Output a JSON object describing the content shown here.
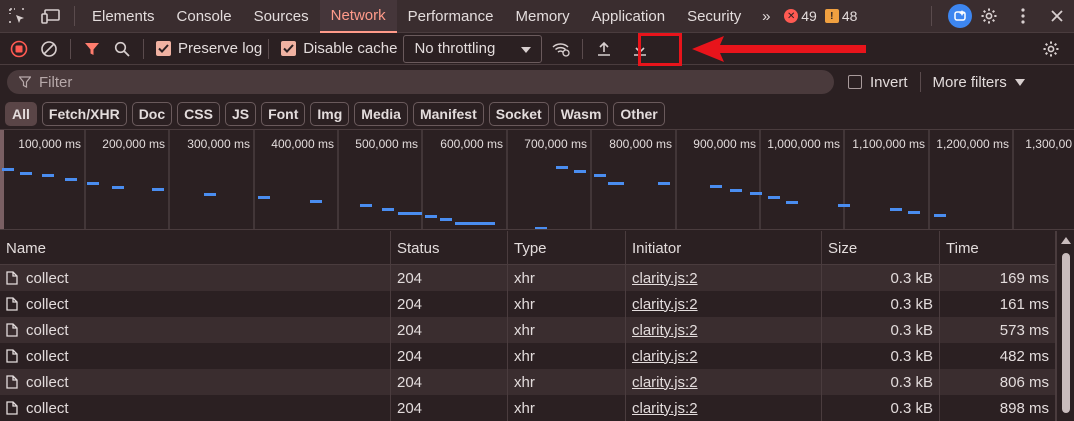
{
  "tabs": [
    {
      "label": "Elements"
    },
    {
      "label": "Console"
    },
    {
      "label": "Sources"
    },
    {
      "label": "Network"
    },
    {
      "label": "Performance"
    },
    {
      "label": "Memory"
    },
    {
      "label": "Application"
    },
    {
      "label": "Security"
    }
  ],
  "active_tab": "Network",
  "badges": {
    "errors": "49",
    "warnings": "48"
  },
  "toolbar": {
    "preserve_log": "Preserve log",
    "disable_cache": "Disable cache",
    "throttling": "No throttling"
  },
  "filter": {
    "placeholder": "Filter",
    "invert": "Invert",
    "more_filters": "More filters"
  },
  "chips": [
    "All",
    "Fetch/XHR",
    "Doc",
    "CSS",
    "JS",
    "Font",
    "Img",
    "Media",
    "Manifest",
    "Socket",
    "Wasm",
    "Other"
  ],
  "overview": {
    "ticks": [
      "100,000 ms",
      "200,000 ms",
      "300,000 ms",
      "400,000 ms",
      "500,000 ms",
      "600,000 ms",
      "700,000 ms",
      "800,000 ms",
      "900,000 ms",
      "1,000,000 ms",
      "1,100,000 ms",
      "1,200,000 ms",
      "1,300,00"
    ]
  },
  "columns": {
    "name": "Name",
    "status": "Status",
    "type": "Type",
    "initiator": "Initiator",
    "size": "Size",
    "time": "Time"
  },
  "rows": [
    {
      "name": "collect",
      "status": "204",
      "type": "xhr",
      "initiator": "clarity.js:2",
      "size": "0.3 kB",
      "time": "169 ms"
    },
    {
      "name": "collect",
      "status": "204",
      "type": "xhr",
      "initiator": "clarity.js:2",
      "size": "0.3 kB",
      "time": "161 ms"
    },
    {
      "name": "collect",
      "status": "204",
      "type": "xhr",
      "initiator": "clarity.js:2",
      "size": "0.3 kB",
      "time": "573 ms"
    },
    {
      "name": "collect",
      "status": "204",
      "type": "xhr",
      "initiator": "clarity.js:2",
      "size": "0.3 kB",
      "time": "482 ms"
    },
    {
      "name": "collect",
      "status": "204",
      "type": "xhr",
      "initiator": "clarity.js:2",
      "size": "0.3 kB",
      "time": "806 ms"
    },
    {
      "name": "collect",
      "status": "204",
      "type": "xhr",
      "initiator": "clarity.js:2",
      "size": "0.3 kB",
      "time": "898 ms"
    }
  ],
  "colors": {
    "accent": "#ff9b8a",
    "highlight": "#e8141b",
    "bar": "#4a8df0"
  }
}
